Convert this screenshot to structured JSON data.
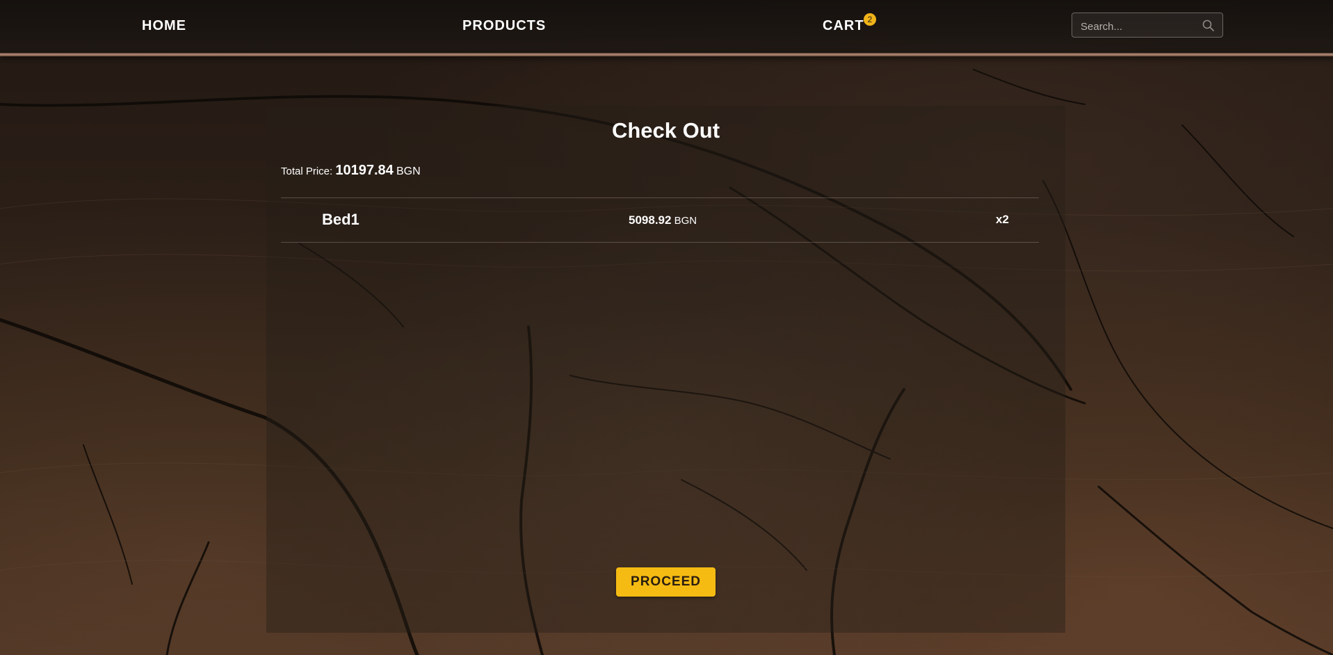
{
  "navbar": {
    "home_label": "HOME",
    "products_label": "PRODUCTS",
    "cart_label": "CART",
    "cart_count": "2",
    "search": {
      "placeholder": "Search...",
      "value": "",
      "icon": "search-icon"
    }
  },
  "checkout": {
    "title": "Check Out",
    "total": {
      "label": "Total Price:",
      "value": "10197.84",
      "currency": "BGN"
    },
    "items": [
      {
        "name": "Bed1",
        "price": "5098.92",
        "currency": "BGN",
        "quantity": "x2"
      }
    ],
    "proceed_label": "PROCEED"
  },
  "colors": {
    "accent": "#f5bb12",
    "badge": "#f0b41a",
    "text": "#ffffff",
    "background": "#2b1f17"
  }
}
